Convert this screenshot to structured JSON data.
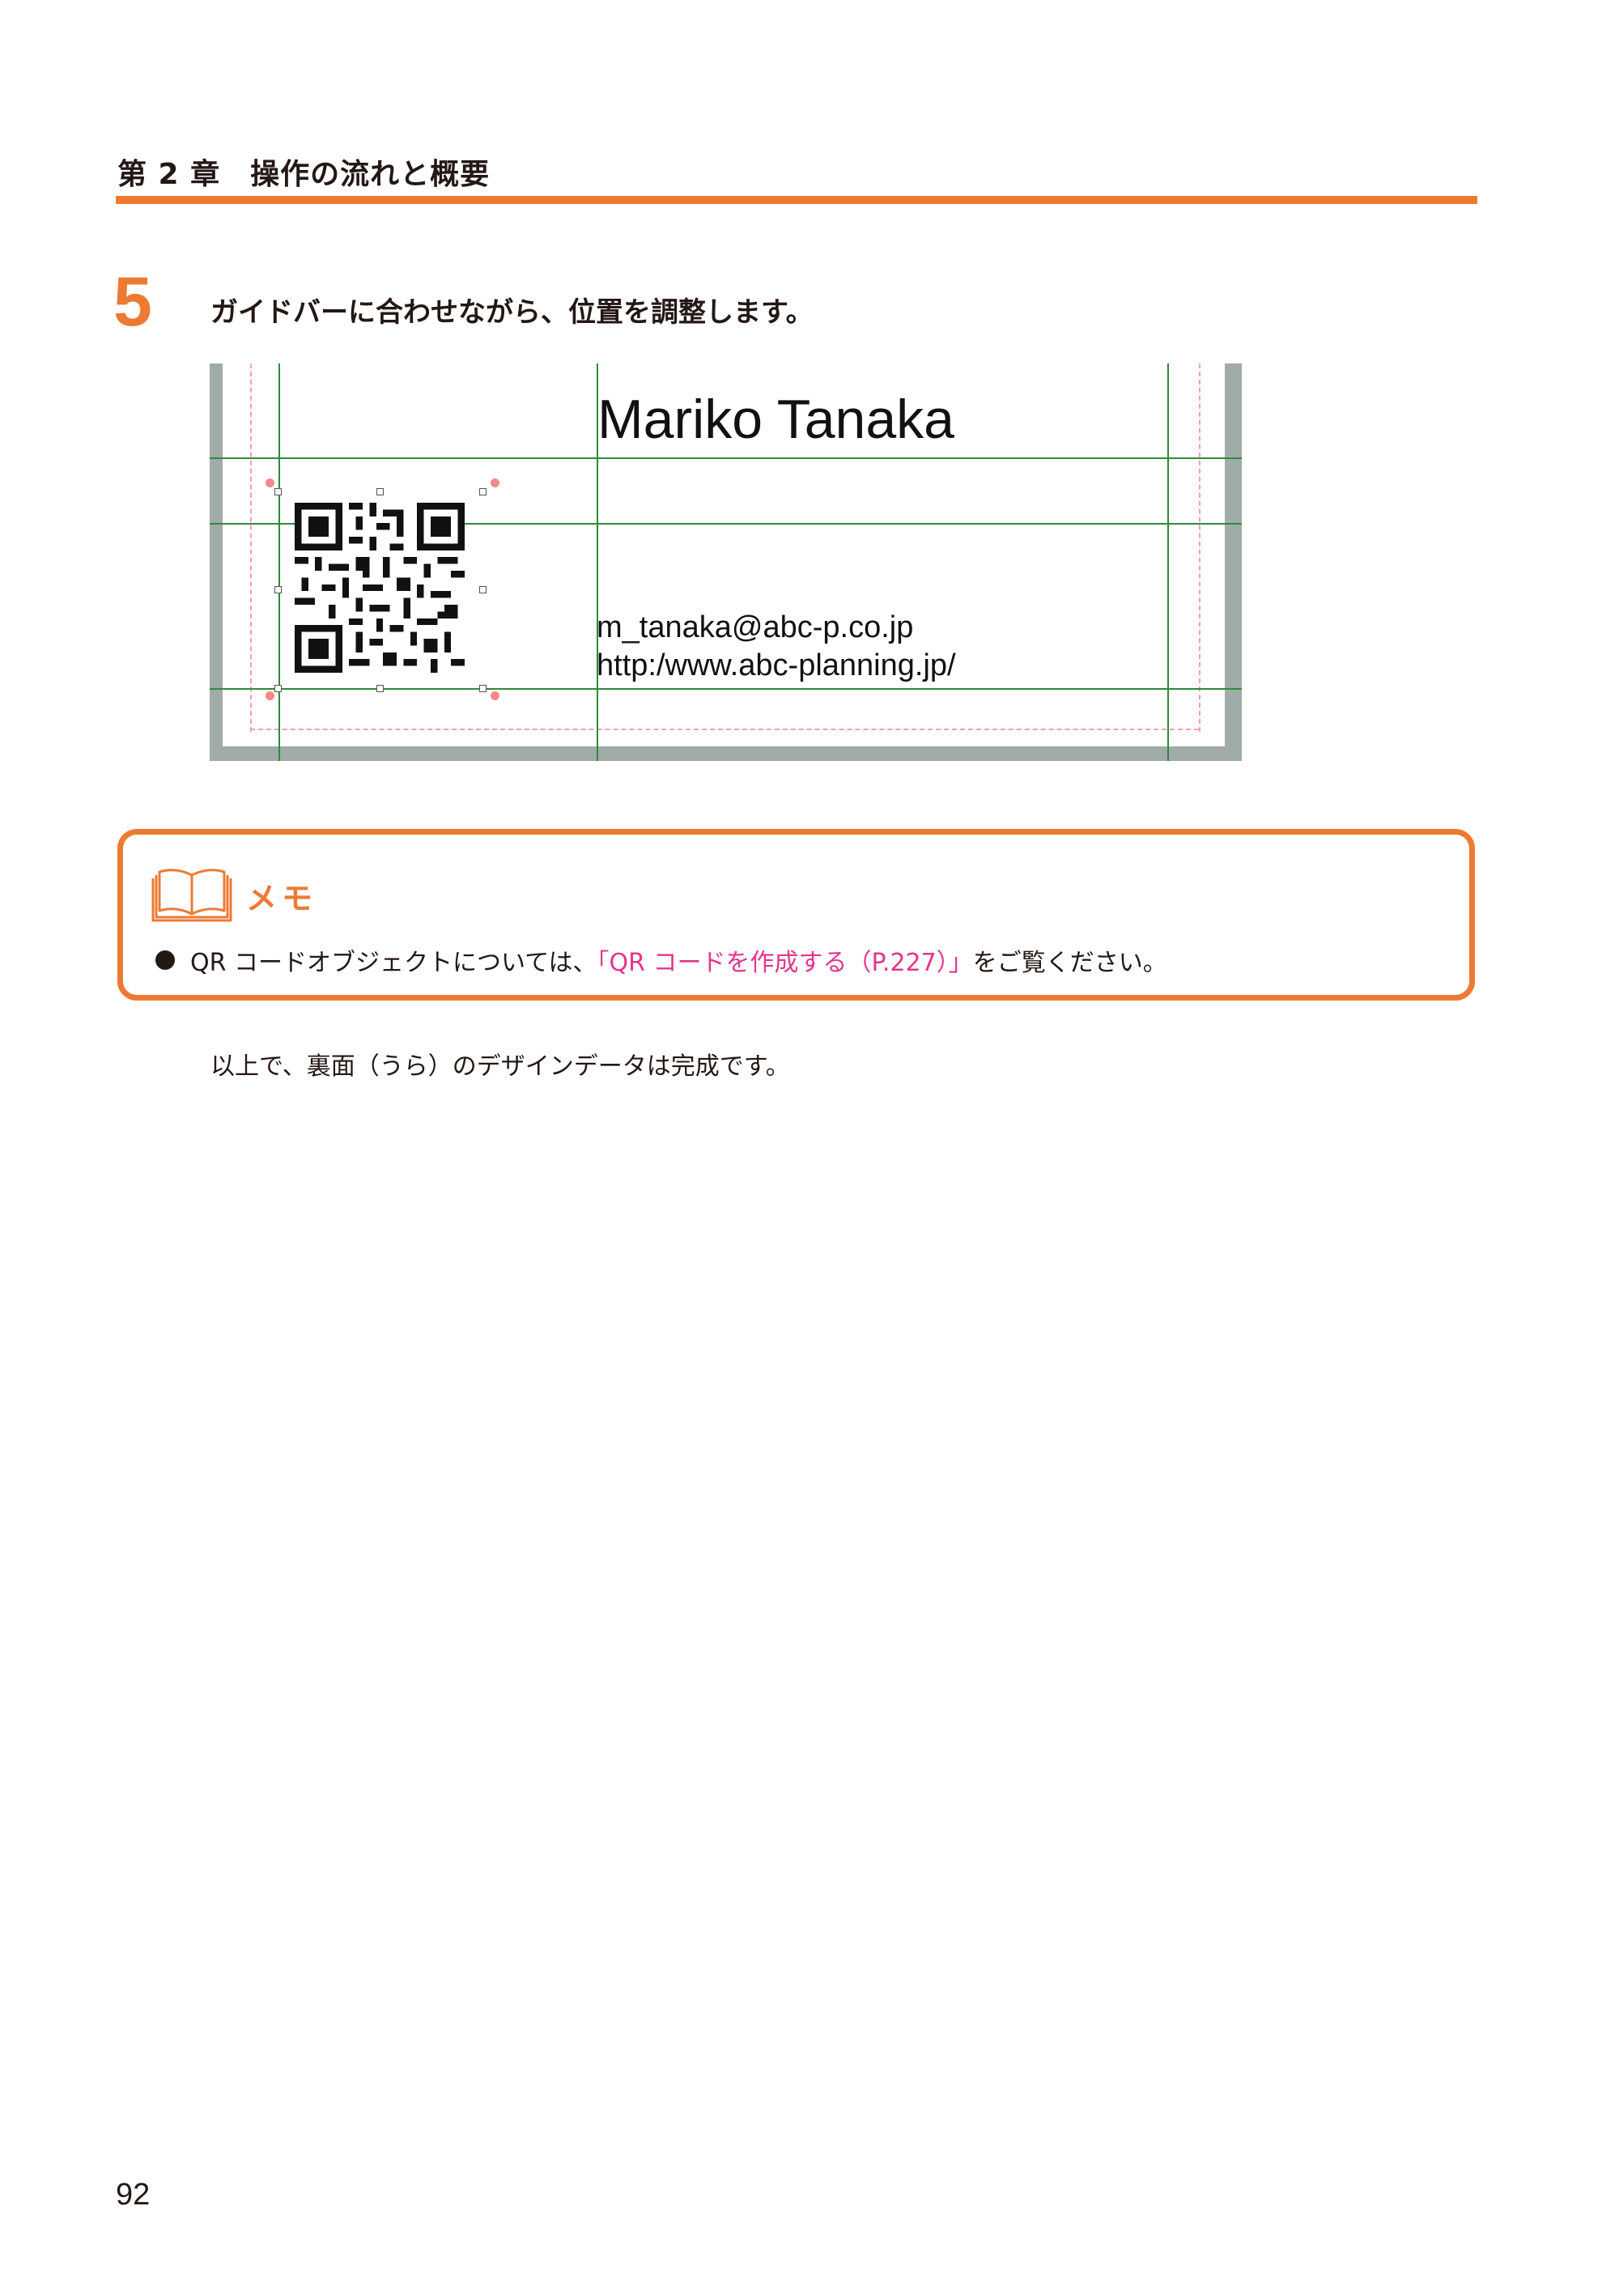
{
  "header": {
    "chapter_title": "第 2 章　操作の流れと概要"
  },
  "step": {
    "number": "5",
    "instruction": "ガイドバーに合わせながら、位置を調整します。"
  },
  "card_screenshot": {
    "name": "Mariko Tanaka",
    "email": "m_tanaka@abc-p.co.jp",
    "url": "http:/www.abc-planning.jp/",
    "colors": {
      "guide_line": "#2f8a3a",
      "trim_line": "#f0a0b4",
      "frame": "#a1aba8",
      "corner_dot": "#f08a8a"
    },
    "qr_icon": "qr-code-icon"
  },
  "memo": {
    "icon": "open-book-icon",
    "title": "メモ",
    "text_before": "QR コードオブジェクトについては、",
    "link_text": "「QR コードを作成する（P.227）」",
    "text_after": "をご覧ください。",
    "accent_color": "#ed7a33",
    "link_color": "#e4358c"
  },
  "body": {
    "conclusion": "以上で、裏面（うら）のデザインデータは完成です。"
  },
  "footer": {
    "page_number": "92"
  }
}
